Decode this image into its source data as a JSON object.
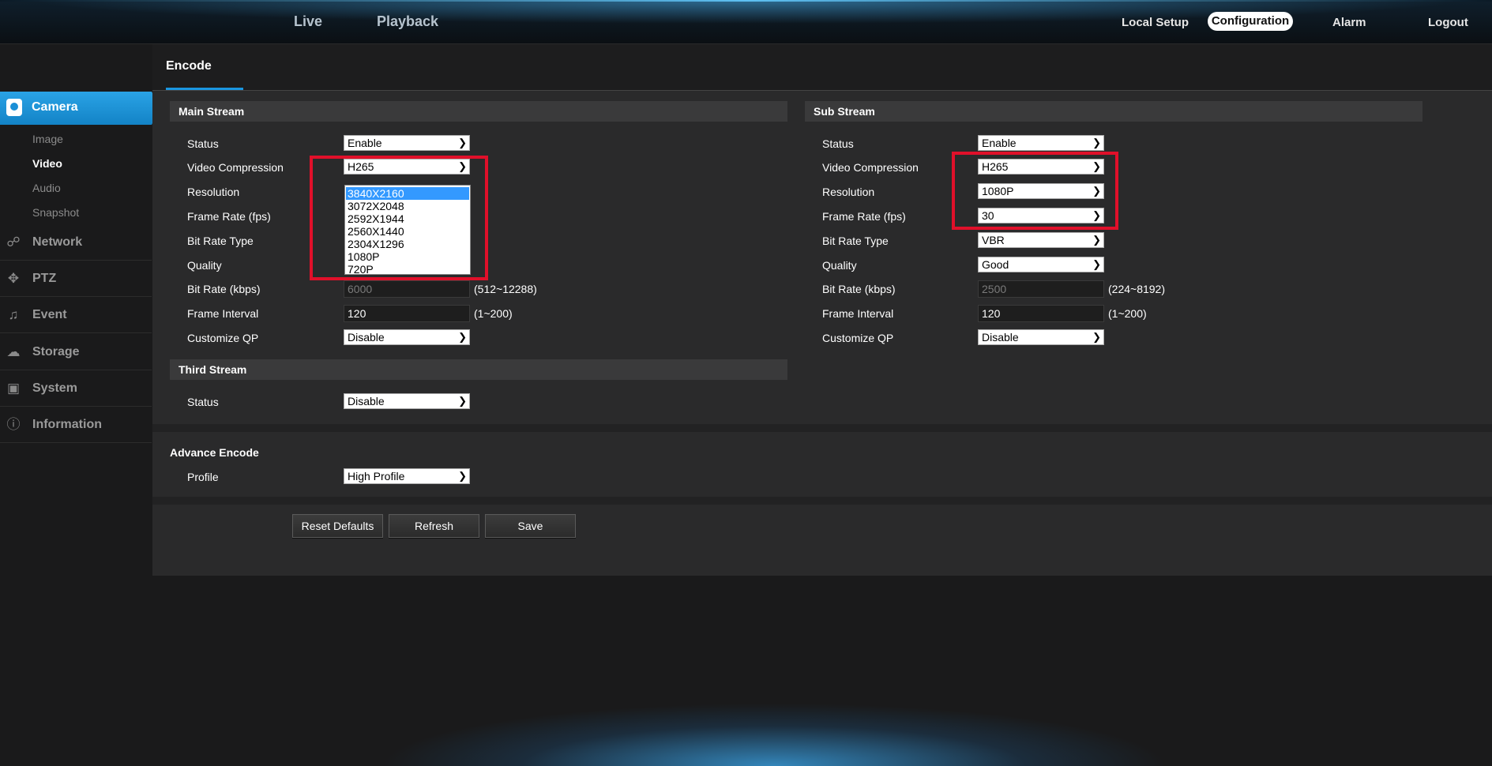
{
  "topnav": {
    "live": "Live",
    "playback": "Playback",
    "local_setup": "Local Setup",
    "configuration": "Configuration",
    "alarm": "Alarm",
    "logout": "Logout"
  },
  "sidebar": {
    "camera": "Camera",
    "camera_sub": [
      "Image",
      "Video",
      "Audio",
      "Snapshot"
    ],
    "active_sub": "Video",
    "items": [
      {
        "label": "Network",
        "icon": "network-icon"
      },
      {
        "label": "PTZ",
        "icon": "ptz-icon"
      },
      {
        "label": "Event",
        "icon": "event-icon"
      },
      {
        "label": "Storage",
        "icon": "storage-icon"
      },
      {
        "label": "System",
        "icon": "system-icon"
      },
      {
        "label": "Information",
        "icon": "information-icon"
      }
    ]
  },
  "tab": "Encode",
  "main_stream": {
    "title": "Main Stream",
    "labels": [
      "Status",
      "Video Compression",
      "Resolution",
      "Frame Rate (fps)",
      "Bit Rate Type",
      "Quality",
      "Bit Rate (kbps)",
      "Frame Interval",
      "Customize QP"
    ],
    "status": "Enable",
    "video_compression": "H265",
    "resolution_options": [
      "3840X2160",
      "3072X2048",
      "2592X1944",
      "2560X1440",
      "2304X1296",
      "1080P",
      "720P"
    ],
    "resolution_selected": "3840X2160",
    "bit_rate": "6000",
    "bit_rate_range": "(512~12288)",
    "frame_interval": "120",
    "frame_interval_range": "(1~200)",
    "customize_qp": "Disable"
  },
  "sub_stream": {
    "title": "Sub Stream",
    "labels": [
      "Status",
      "Video Compression",
      "Resolution",
      "Frame Rate (fps)",
      "Bit Rate Type",
      "Quality",
      "Bit Rate (kbps)",
      "Frame Interval",
      "Customize QP"
    ],
    "status": "Enable",
    "video_compression": "H265",
    "resolution": "1080P",
    "frame_rate": "30",
    "bit_rate_type": "VBR",
    "quality": "Good",
    "bit_rate": "2500",
    "bit_rate_range": "(224~8192)",
    "frame_interval": "120",
    "frame_interval_range": "(1~200)",
    "customize_qp": "Disable"
  },
  "third_stream": {
    "title": "Third Stream",
    "status_label": "Status",
    "status": "Disable"
  },
  "advance_encode": {
    "title": "Advance Encode",
    "profile_label": "Profile",
    "profile": "High Profile"
  },
  "buttons": {
    "reset": "Reset Defaults",
    "refresh": "Refresh",
    "save": "Save"
  },
  "colors": {
    "accent": "#1a96e0",
    "highlight_box": "#e0102a",
    "panel_bg": "#2a2a2b"
  }
}
